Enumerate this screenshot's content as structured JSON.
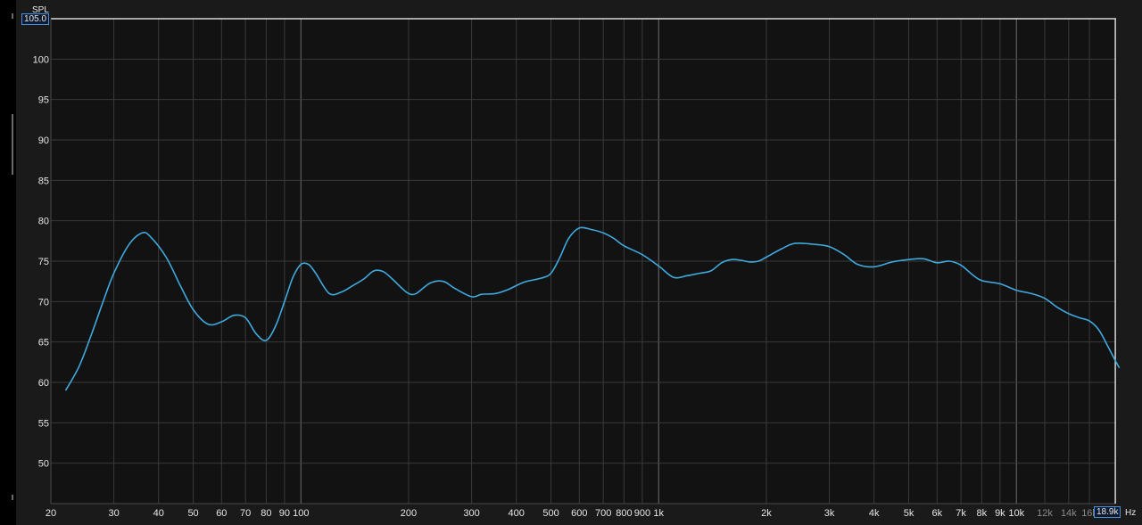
{
  "chart_data": {
    "type": "line",
    "ylabel": "SPL",
    "xlabel": "Hz",
    "x_scale": "log",
    "xlim": [
      20,
      19000
    ],
    "ylim": [
      45,
      105
    ],
    "grid": true,
    "y_ticks": [
      50,
      55,
      60,
      65,
      70,
      75,
      80,
      85,
      90,
      95,
      100
    ],
    "x_ticks": [
      {
        "v": 20,
        "label": "20",
        "major": false
      },
      {
        "v": 30,
        "label": "30",
        "major": false
      },
      {
        "v": 40,
        "label": "40",
        "major": false
      },
      {
        "v": 50,
        "label": "50",
        "major": false
      },
      {
        "v": 60,
        "label": "60",
        "major": false
      },
      {
        "v": 70,
        "label": "70",
        "major": false
      },
      {
        "v": 80,
        "label": "80",
        "major": false
      },
      {
        "v": 90,
        "label": "90",
        "major": false
      },
      {
        "v": 100,
        "label": "100",
        "major": true
      },
      {
        "v": 200,
        "label": "200",
        "major": false
      },
      {
        "v": 300,
        "label": "300",
        "major": false
      },
      {
        "v": 400,
        "label": "400",
        "major": false
      },
      {
        "v": 500,
        "label": "500",
        "major": false
      },
      {
        "v": 600,
        "label": "600",
        "major": false
      },
      {
        "v": 700,
        "label": "700",
        "major": false
      },
      {
        "v": 800,
        "label": "800",
        "major": false
      },
      {
        "v": 900,
        "label": "900",
        "major": false
      },
      {
        "v": 1000,
        "label": "1k",
        "major": true
      },
      {
        "v": 2000,
        "label": "2k",
        "major": false
      },
      {
        "v": 3000,
        "label": "3k",
        "major": false
      },
      {
        "v": 4000,
        "label": "4k",
        "major": false
      },
      {
        "v": 5000,
        "label": "5k",
        "major": false
      },
      {
        "v": 6000,
        "label": "6k",
        "major": false
      },
      {
        "v": 7000,
        "label": "7k",
        "major": false
      },
      {
        "v": 8000,
        "label": "8k",
        "major": false
      },
      {
        "v": 9000,
        "label": "9k",
        "major": false
      },
      {
        "v": 10000,
        "label": "10k",
        "major": true
      },
      {
        "v": 12000,
        "label": "12k",
        "major": false,
        "dim": true
      },
      {
        "v": 14000,
        "label": "14k",
        "major": false,
        "dim": true
      },
      {
        "v": 16000,
        "label": "16k",
        "major": false,
        "dim": true
      }
    ],
    "y_max_label": "105.0",
    "x_max_label": "18.9k",
    "series": [
      {
        "color": "#3fa9de",
        "points": [
          [
            22,
            59
          ],
          [
            24,
            62
          ],
          [
            26,
            66
          ],
          [
            28,
            70
          ],
          [
            30,
            73.5
          ],
          [
            33,
            77
          ],
          [
            36,
            78.5
          ],
          [
            38,
            78
          ],
          [
            42,
            75.5
          ],
          [
            46,
            72
          ],
          [
            50,
            69
          ],
          [
            55,
            67.2
          ],
          [
            60,
            67.5
          ],
          [
            65,
            68.3
          ],
          [
            70,
            68
          ],
          [
            75,
            66
          ],
          [
            80,
            65.2
          ],
          [
            85,
            67
          ],
          [
            90,
            70
          ],
          [
            95,
            73
          ],
          [
            100,
            74.6
          ],
          [
            105,
            74.6
          ],
          [
            110,
            73.5
          ],
          [
            120,
            71
          ],
          [
            130,
            71.2
          ],
          [
            140,
            72
          ],
          [
            150,
            72.8
          ],
          [
            160,
            73.8
          ],
          [
            170,
            73.7
          ],
          [
            180,
            72.8
          ],
          [
            190,
            71.8
          ],
          [
            200,
            71
          ],
          [
            210,
            71
          ],
          [
            230,
            72.3
          ],
          [
            250,
            72.5
          ],
          [
            270,
            71.6
          ],
          [
            300,
            70.6
          ],
          [
            320,
            70.9
          ],
          [
            350,
            71
          ],
          [
            380,
            71.5
          ],
          [
            420,
            72.4
          ],
          [
            470,
            72.9
          ],
          [
            500,
            73.5
          ],
          [
            530,
            75.5
          ],
          [
            560,
            77.8
          ],
          [
            600,
            79.1
          ],
          [
            650,
            78.9
          ],
          [
            700,
            78.5
          ],
          [
            750,
            77.8
          ],
          [
            800,
            76.9
          ],
          [
            900,
            75.8
          ],
          [
            1000,
            74.4
          ],
          [
            1100,
            73
          ],
          [
            1200,
            73.2
          ],
          [
            1300,
            73.5
          ],
          [
            1400,
            73.8
          ],
          [
            1500,
            74.8
          ],
          [
            1600,
            75.2
          ],
          [
            1700,
            75.1
          ],
          [
            1800,
            74.9
          ],
          [
            1900,
            75
          ],
          [
            2000,
            75.5
          ],
          [
            2200,
            76.5
          ],
          [
            2400,
            77.2
          ],
          [
            2700,
            77.1
          ],
          [
            3000,
            76.8
          ],
          [
            3300,
            75.8
          ],
          [
            3600,
            74.6
          ],
          [
            4000,
            74.3
          ],
          [
            4500,
            74.9
          ],
          [
            5000,
            75.2
          ],
          [
            5500,
            75.3
          ],
          [
            6000,
            74.8
          ],
          [
            6500,
            75
          ],
          [
            7000,
            74.5
          ],
          [
            7500,
            73.4
          ],
          [
            8000,
            72.6
          ],
          [
            9000,
            72.2
          ],
          [
            10000,
            71.4
          ],
          [
            11000,
            71
          ],
          [
            12000,
            70.4
          ],
          [
            13000,
            69.3
          ],
          [
            14000,
            68.5
          ],
          [
            15000,
            68.0
          ],
          [
            16000,
            67.6
          ],
          [
            17000,
            66.5
          ],
          [
            18000,
            64.5
          ],
          [
            19000,
            62.5
          ],
          [
            19400,
            61.8
          ]
        ]
      }
    ]
  }
}
